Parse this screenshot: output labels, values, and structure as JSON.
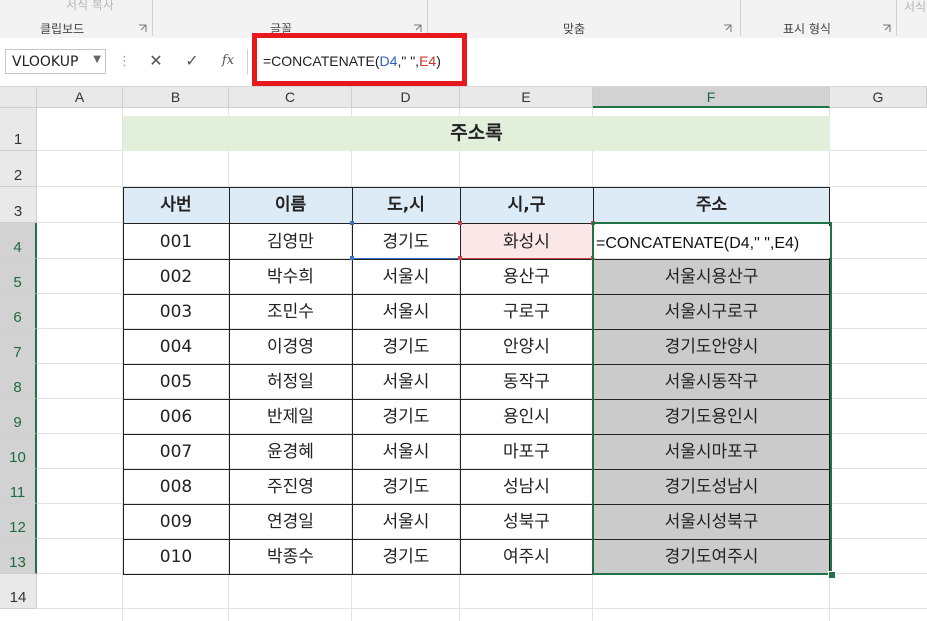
{
  "ribbon": {
    "top_faded_label": "서식 복사",
    "groups": [
      "클립보드",
      "글꼴",
      "맞춤",
      "표시 형식"
    ],
    "right_faded": "서식"
  },
  "formula_bar": {
    "name_box": "VLOOKUP",
    "cancel_icon": "✕",
    "enter_icon": "✓",
    "fx_label": "fx",
    "formula_parts": [
      {
        "text": "=CONCATENATE(",
        "color": "#222222"
      },
      {
        "text": "D4",
        "color": "#2f5fc2"
      },
      {
        "text": ",\" \",",
        "color": "#222222"
      },
      {
        "text": "E4",
        "color": "#c0392b"
      },
      {
        "text": ")",
        "color": "#222222"
      }
    ]
  },
  "columns": [
    "A",
    "B",
    "C",
    "D",
    "E",
    "F",
    "G"
  ],
  "rows": [
    "1",
    "2",
    "3",
    "4",
    "5",
    "6",
    "7",
    "8",
    "9",
    "10",
    "11",
    "12",
    "13",
    "14"
  ],
  "sheet": {
    "title": "주소록",
    "headers": [
      "사번",
      "이름",
      "도,시",
      "시,구",
      "주소"
    ],
    "editing_formula": "=CONCATENATE(D4,\" \",E4)",
    "records": [
      {
        "id": "001",
        "name": "김영만",
        "do": "경기도",
        "si": "화성시",
        "addr": ""
      },
      {
        "id": "002",
        "name": "박수희",
        "do": "서울시",
        "si": "용산구",
        "addr": "서울시용산구"
      },
      {
        "id": "003",
        "name": "조민수",
        "do": "서울시",
        "si": "구로구",
        "addr": "서울시구로구"
      },
      {
        "id": "004",
        "name": "이경영",
        "do": "경기도",
        "si": "안양시",
        "addr": "경기도안양시"
      },
      {
        "id": "005",
        "name": "허정일",
        "do": "서울시",
        "si": "동작구",
        "addr": "서울시동작구"
      },
      {
        "id": "006",
        "name": "반제일",
        "do": "경기도",
        "si": "용인시",
        "addr": "경기도용인시"
      },
      {
        "id": "007",
        "name": "윤경혜",
        "do": "서울시",
        "si": "마포구",
        "addr": "서울시마포구"
      },
      {
        "id": "008",
        "name": "주진영",
        "do": "경기도",
        "si": "성남시",
        "addr": "경기도성남시"
      },
      {
        "id": "009",
        "name": "연경일",
        "do": "서울시",
        "si": "성북구",
        "addr": "서울시성북구"
      },
      {
        "id": "010",
        "name": "박종수",
        "do": "경기도",
        "si": "여주시",
        "addr": "경기도여주시"
      }
    ]
  },
  "colors": {
    "title_fill": "#e2efda",
    "header_fill": "#ddebf7",
    "result_fill": "#cbcbcb",
    "selection": "#217346",
    "callout": "#e8191c"
  }
}
